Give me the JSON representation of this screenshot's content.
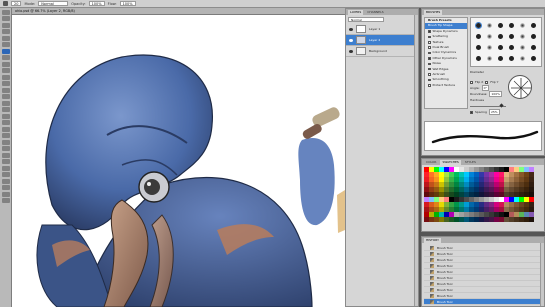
{
  "options_bar": {
    "brush_size": "20",
    "mode_label": "Mode:",
    "mode_value": "Normal",
    "opacity_label": "Opacity:",
    "opacity_value": "100%",
    "flow_label": "Flow:",
    "flow_value": "100%"
  },
  "document": {
    "tab_title": "ohio.psd @ 66.7% (Layer 2, RGB/8)"
  },
  "layers_panel": {
    "tabs": [
      "LAYERS",
      "CHANNELS"
    ],
    "active_tab": "LAYERS",
    "blend_mode": "Normal",
    "layers": [
      {
        "name": "Layer 1"
      },
      {
        "name": "Layer 2",
        "selected": true
      },
      {
        "name": "Background"
      }
    ]
  },
  "brushes_panel": {
    "tabs": [
      "BRUSHES"
    ],
    "preset_button": "Brush Presets",
    "items": [
      {
        "label": "Brush Tip Shape",
        "selected": true
      },
      {
        "label": "Shape Dynamics",
        "checked": true
      },
      {
        "label": "Scattering",
        "checked": false
      },
      {
        "label": "Texture",
        "checked": false
      },
      {
        "label": "Dual Brush",
        "checked": false
      },
      {
        "label": "Color Dynamics",
        "checked": false
      },
      {
        "label": "Other Dynamics",
        "checked": true
      },
      {
        "label": "Noise",
        "checked": false
      },
      {
        "label": "Wet Edges",
        "checked": false
      },
      {
        "label": "Airbrush",
        "checked": false
      },
      {
        "label": "Smoothing",
        "checked": true
      },
      {
        "label": "Protect Texture",
        "checked": false
      }
    ],
    "diameter_label": "Diameter",
    "flip_x": "Flip X",
    "flip_y": "Flip Y",
    "angle_label": "Angle:",
    "angle_value": "0°",
    "roundness_label": "Roundness:",
    "roundness_value": "100%",
    "hardness_label": "Hardness",
    "spacing_label": "Spacing",
    "spacing_value": "25%"
  },
  "swatches_panel": {
    "tabs": [
      "COLOR",
      "SWATCHES",
      "STYLES"
    ],
    "active_tab": "SWATCHES"
  },
  "history_panel": {
    "tabs": [
      "HISTORY"
    ],
    "rows": [
      "Brush Tool",
      "Brush Tool",
      "Brush Tool",
      "Brush Tool",
      "Brush Tool",
      "Brush Tool",
      "Brush Tool",
      "Brush Tool",
      "Brush Tool",
      "Brush Tool"
    ],
    "active_index": 9
  },
  "colors": {
    "creature_blue": "#4a6aa8",
    "creature_dark": "#2f426e",
    "creature_light": "#6d8cc5",
    "beak": "#b98b6f",
    "wing_brown": "#b87c5c",
    "selection_blue": "#3d7fcf"
  }
}
